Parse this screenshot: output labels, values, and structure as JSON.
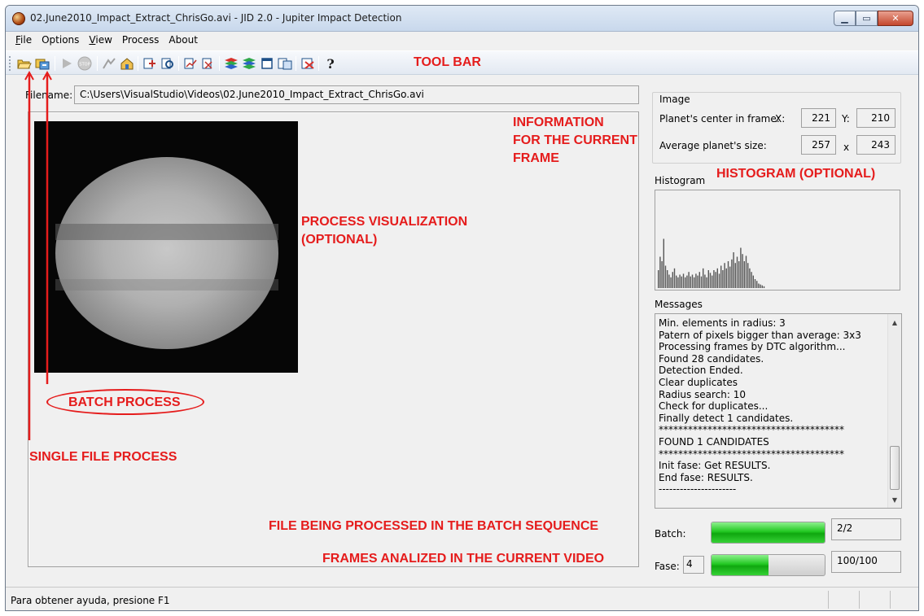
{
  "window": {
    "title": "02.June2010_Impact_Extract_ChrisGo.avi - JID 2.0 - Jupiter Impact Detection",
    "controls": {
      "minimize_icon": "minimize-icon",
      "maximize_icon": "maximize-icon",
      "close_icon": "close-icon"
    }
  },
  "menu": {
    "items": [
      {
        "label": "File",
        "underline": "F",
        "rest": "ile"
      },
      {
        "label": "Options",
        "underline": "",
        "rest": "Options"
      },
      {
        "label": "View",
        "underline": "V",
        "rest": "iew"
      },
      {
        "label": "Process",
        "underline": "",
        "rest": "Process"
      },
      {
        "label": "About",
        "underline": "",
        "rest": "About"
      }
    ]
  },
  "toolbar": {
    "buttons": [
      "open-file-icon",
      "batch-open-icon",
      "play-icon",
      "stop-icon",
      "tool-a-icon",
      "tool-b-icon",
      "tool-c-icon",
      "tool-d-icon",
      "tool-e-icon",
      "tool-f-icon",
      "layers-a-icon",
      "layers-b-icon",
      "window-icon",
      "export-icon",
      "settings-icon",
      "help-icon"
    ]
  },
  "file": {
    "label": "Filename:",
    "path": "C:\\Users\\VisualStudio\\Videos\\02.June2010_Impact_Extract_ChrisGo.avi"
  },
  "image_info": {
    "group_title": "Image",
    "center_label": "Planet's center in frame:",
    "x_label": "X:",
    "x_value": "221",
    "y_label": "Y:",
    "y_value": "210",
    "size_label": "Average planet's size:",
    "size_w": "257",
    "size_sep": "x",
    "size_h": "243"
  },
  "histogram": {
    "title": "Histogram",
    "bars": [
      0.2,
      0.35,
      0.3,
      0.55,
      0.25,
      0.2,
      0.15,
      0.12,
      0.18,
      0.22,
      0.14,
      0.12,
      0.15,
      0.13,
      0.16,
      0.12,
      0.14,
      0.18,
      0.13,
      0.15,
      0.12,
      0.16,
      0.14,
      0.18,
      0.13,
      0.22,
      0.15,
      0.12,
      0.2,
      0.17,
      0.14,
      0.2,
      0.18,
      0.22,
      0.16,
      0.25,
      0.2,
      0.28,
      0.22,
      0.3,
      0.24,
      0.32,
      0.4,
      0.28,
      0.35,
      0.3,
      0.45,
      0.38,
      0.3,
      0.36,
      0.28,
      0.22,
      0.18,
      0.14,
      0.1,
      0.08,
      0.05,
      0.04,
      0.03,
      0.02
    ]
  },
  "messages": {
    "title": "Messages",
    "lines": [
      "Min. elements in radius: 3",
      "Patern of pixels bigger than average: 3x3",
      "Processing frames by DTC algorithm...",
      "Found 28 candidates.",
      "Detection Ended.",
      "Clear duplicates",
      "Radius search: 10",
      "Check for duplicates...",
      "Finally detect 1 candidates.",
      "**************************************",
      "FOUND 1 CANDIDATES",
      "**************************************",
      "Init fase: Get RESULTS.",
      "End fase: RESULTS.",
      "----------------------"
    ]
  },
  "batch": {
    "label": "Batch:",
    "progress": 1.0,
    "status": "2/2"
  },
  "fase": {
    "label": "Fase:",
    "value": "4",
    "progress": 0.5,
    "status": "100/100"
  },
  "statusbar": {
    "text": "Para obtener ayuda, presione F1"
  },
  "annotations": {
    "tool_bar": "TOOL BAR",
    "information_line1": "INFORMATION",
    "information_line2": "FOR THE CURRENT",
    "information_line3": "FRAME",
    "histogram": "HISTOGRAM (OPTIONAL)",
    "process_vis_line1": "PROCESS VISUALIZATION",
    "process_vis_line2": "(OPTIONAL)",
    "batch_process": "BATCH PROCESS",
    "single_file": "SINGLE FILE PROCESS",
    "file_batch": "FILE BEING PROCESSED IN THE BATCH SEQUENCE",
    "frames_analized": "FRAMES ANALIZED IN THE CURRENT VIDEO"
  },
  "colors": {
    "annotation": "#e51c1c",
    "progress_fill": "#22c822",
    "background": "#f0f0f0"
  }
}
